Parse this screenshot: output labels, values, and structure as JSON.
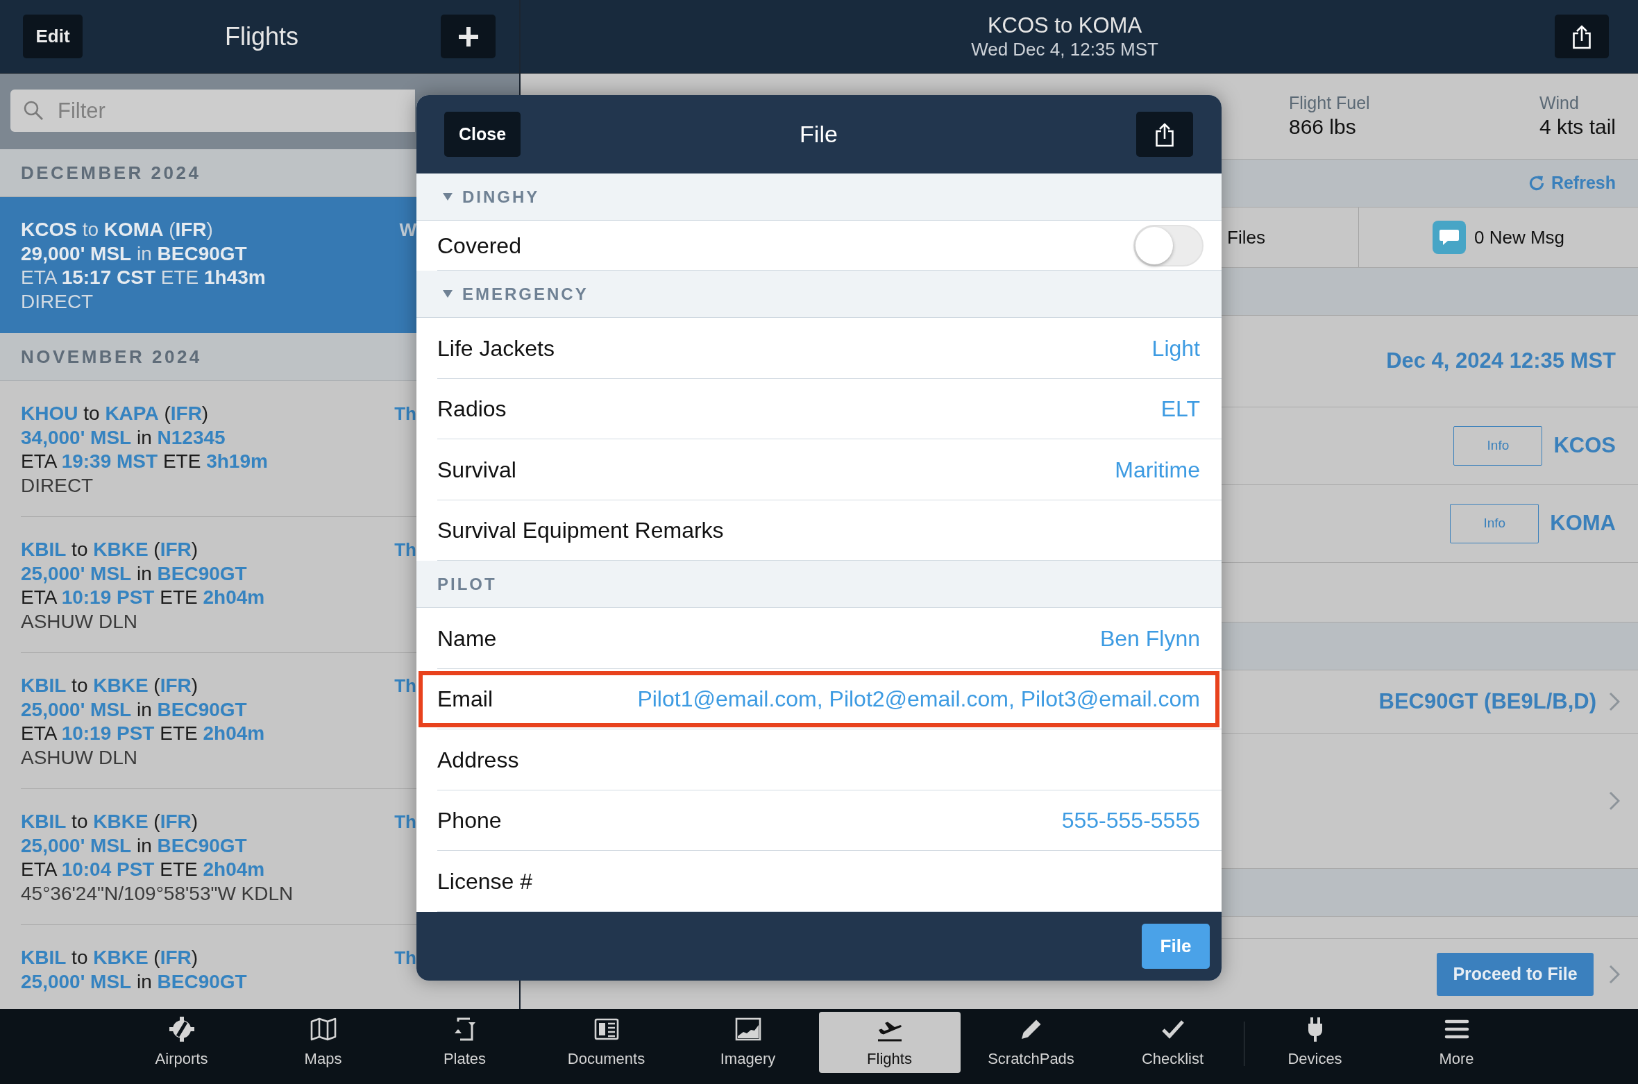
{
  "sidebar": {
    "edit_button": "Edit",
    "title": "Flights",
    "filter": {
      "placeholder": "Filter"
    },
    "sections": [
      {
        "title": "DECEMBER 2024",
        "flights": [
          {
            "lines": [
              "**KCOS** to **KOMA** (**IFR**)",
              "**29,000' MSL** in **BEC90GT**",
              "ETA **15:17 CST** ETE **1h43m**",
              "DIRECT"
            ],
            "date": "W",
            "selected": true
          }
        ]
      },
      {
        "title": "NOVEMBER 2024",
        "flights": [
          {
            "lines": [
              "**KHOU** to **KAPA** (**IFR**)",
              "**34,000' MSL** in **N12345**",
              "ETA **19:39 MST** ETE **3h19m**",
              "DIRECT"
            ],
            "date": "Th",
            "selected": false
          },
          {
            "lines": [
              "**KBIL** to **KBKE** (**IFR**)",
              "**25,000' MSL** in **BEC90GT**",
              "ETA **10:19 PST** ETE **2h04m**",
              "ASHUW DLN"
            ],
            "date": "Th",
            "selected": false
          },
          {
            "lines": [
              "**KBIL** to **KBKE** (**IFR**)",
              "**25,000' MSL** in **BEC90GT**",
              "ETA **10:19 PST** ETE **2h04m**",
              "ASHUW DLN"
            ],
            "date": "Th",
            "selected": false
          },
          {
            "lines": [
              "**KBIL** to **KBKE** (**IFR**)",
              "**25,000' MSL** in **BEC90GT**",
              "ETA **10:04 PST** ETE **2h04m**",
              "45°36'24\"N/109°58'53\"W KDLN"
            ],
            "date": "Th",
            "selected": false
          },
          {
            "lines": [
              "**KBIL** to **KBKE** (**IFR**)",
              "**25,000' MSL** in **BEC90GT**"
            ],
            "date": "Th",
            "selected": false
          }
        ]
      }
    ]
  },
  "detail": {
    "title": "KCOS to KOMA",
    "subtitle": "Wed Dec 4, 12:35 MST",
    "rows": [
      {
        "kind": "summary",
        "items": [
          {
            "label": "Flight Fuel",
            "value": "866 lbs"
          },
          {
            "label": "Wind",
            "value": "4 kts tail"
          }
        ]
      },
      {
        "kind": "header",
        "action": "Refresh"
      },
      {
        "kind": "actions",
        "items": [
          {
            "kind": "files",
            "label": "Files"
          },
          {
            "kind": "messages",
            "label": "0 New Msg"
          }
        ]
      },
      {
        "kind": "header"
      },
      {
        "kind": "value",
        "value": "Dec 4, 2024 12:35 MST"
      },
      {
        "kind": "airport",
        "button": "Info",
        "value": "KCOS"
      },
      {
        "kind": "airport",
        "button": "Info",
        "value": "KOMA"
      },
      {
        "kind": "blank"
      },
      {
        "kind": "header"
      },
      {
        "kind": "link",
        "value": "BEC90GT (BE9L/B,D)"
      },
      {
        "kind": "note"
      },
      {
        "kind": "header"
      },
      {
        "kind": "button",
        "button": "Proceed to File"
      }
    ]
  },
  "dialog": {
    "close_button": "Close",
    "title": "File",
    "sections": [
      {
        "title": "DINGHY",
        "collapsible": true,
        "rows": [
          {
            "kind": "toggle",
            "label": "Covered",
            "on": false,
            "highlighted": false
          }
        ]
      },
      {
        "title": "EMERGENCY",
        "collapsible": true,
        "rows": [
          {
            "kind": "value",
            "label": "Life Jackets",
            "value": "Light",
            "highlighted": false
          },
          {
            "kind": "value",
            "label": "Radios",
            "value": "ELT",
            "highlighted": false
          },
          {
            "kind": "value",
            "label": "Survival",
            "value": "Maritime",
            "highlighted": false
          },
          {
            "kind": "value",
            "label": "Survival Equipment Remarks",
            "highlighted": false
          }
        ]
      },
      {
        "title": "PILOT",
        "collapsible": false,
        "rows": [
          {
            "kind": "value",
            "label": "Name",
            "value": "Ben Flynn",
            "highlighted": false
          },
          {
            "kind": "value",
            "label": "Email",
            "value": "Pilot1@email.com, Pilot2@email.com, Pilot3@email.com",
            "highlighted": true
          },
          {
            "kind": "value",
            "label": "Address",
            "highlighted": false
          },
          {
            "kind": "value",
            "label": "Phone",
            "value": "555-555-5555",
            "highlighted": false
          },
          {
            "kind": "value",
            "label": "License #",
            "highlighted": false
          }
        ]
      }
    ],
    "file_button": "File"
  },
  "tab_bar": {
    "groups": [
      {
        "items": [
          {
            "label": "Airports",
            "selected": false
          },
          {
            "label": "Maps",
            "selected": false
          },
          {
            "label": "Plates",
            "selected": false
          },
          {
            "label": "Documents",
            "selected": false
          },
          {
            "label": "Imagery",
            "selected": false
          },
          {
            "label": "Flights",
            "selected": true
          },
          {
            "label": "ScratchPads",
            "selected": false
          },
          {
            "label": "Checklist",
            "selected": false
          }
        ]
      },
      {
        "items": [
          {
            "label": "Devices",
            "selected": false
          },
          {
            "label": "More",
            "selected": false
          }
        ]
      }
    ]
  }
}
